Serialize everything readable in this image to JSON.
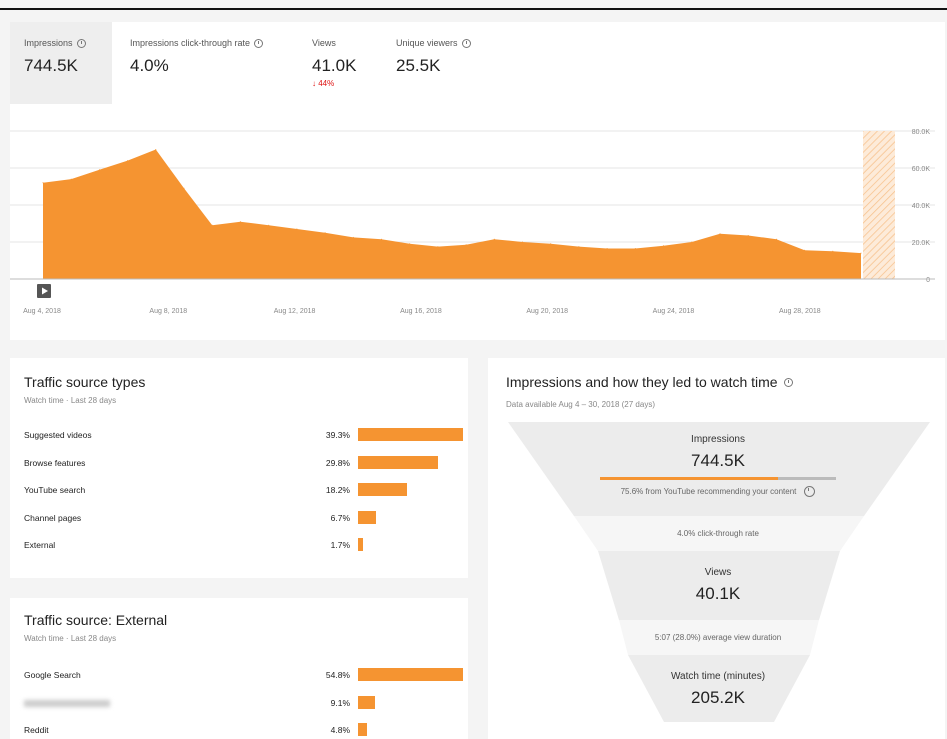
{
  "overview": {
    "metrics": [
      {
        "label": "Impressions",
        "value": "744.5K",
        "delta": ""
      },
      {
        "label": "Impressions click-through rate",
        "value": "4.0%",
        "delta": ""
      },
      {
        "label": "Views",
        "value": "41.0K",
        "delta": "44%"
      },
      {
        "label": "Unique viewers",
        "value": "25.5K",
        "delta": ""
      }
    ]
  },
  "chart_data": {
    "type": "area",
    "title": "",
    "xlabel": "",
    "ylabel": "",
    "x_tick_labels": [
      "Aug 4, 2018",
      "Aug 8, 2018",
      "Aug 12, 2018",
      "Aug 16, 2018",
      "Aug 20, 2018",
      "Aug 24, 2018",
      "Aug 28, 2018"
    ],
    "y_tick_labels": [
      "0",
      "20.0K",
      "40.0K",
      "60.0K",
      "80.0K"
    ],
    "ylim": [
      0,
      80000
    ],
    "x": [
      "Aug 4, 2018",
      "Aug 5, 2018",
      "Aug 6, 2018",
      "Aug 7, 2018",
      "Aug 8, 2018",
      "Aug 9, 2018",
      "Aug 10, 2018",
      "Aug 11, 2018",
      "Aug 12, 2018",
      "Aug 13, 2018",
      "Aug 14, 2018",
      "Aug 15, 2018",
      "Aug 16, 2018",
      "Aug 17, 2018",
      "Aug 18, 2018",
      "Aug 19, 2018",
      "Aug 20, 2018",
      "Aug 21, 2018",
      "Aug 22, 2018",
      "Aug 23, 2018",
      "Aug 24, 2018",
      "Aug 25, 2018",
      "Aug 26, 2018",
      "Aug 27, 2018",
      "Aug 28, 2018",
      "Aug 29, 2018",
      "Aug 30, 2018"
    ],
    "series": [
      {
        "values": [
          52000,
          54000,
          59000,
          64000,
          70000,
          49000,
          29000,
          31000,
          29000,
          27000,
          25000,
          22500,
          21500,
          19000,
          17500,
          18500,
          21500,
          20000,
          19000,
          17500,
          16500,
          16500,
          18000,
          20000,
          24500,
          23500,
          21500,
          15500,
          15000,
          14000
        ]
      }
    ],
    "grid": true,
    "color": "#f59431",
    "partial_period_shaded": true
  },
  "traffic_types": {
    "title": "Traffic source types",
    "subtitle": "Watch time · Last 28 days",
    "rows": [
      {
        "label": "Suggested videos",
        "pct": "39.3%",
        "value": 39.3
      },
      {
        "label": "Browse features",
        "pct": "29.8%",
        "value": 29.8
      },
      {
        "label": "YouTube search",
        "pct": "18.2%",
        "value": 18.2
      },
      {
        "label": "Channel pages",
        "pct": "6.7%",
        "value": 6.7
      },
      {
        "label": "External",
        "pct": "1.7%",
        "value": 1.7
      }
    ]
  },
  "traffic_external": {
    "title": "Traffic source: External",
    "subtitle": "Watch time · Last 28 days",
    "rows": [
      {
        "label": "Google Search",
        "pct": "54.8%",
        "value": 54.8,
        "blurred": false
      },
      {
        "label": "",
        "pct": "9.1%",
        "value": 9.1,
        "blurred": true
      },
      {
        "label": "Reddit",
        "pct": "4.8%",
        "value": 4.8,
        "blurred": false
      }
    ]
  },
  "funnel": {
    "title": "Impressions and how they led to watch time",
    "subtitle": "Data available Aug 4 – 30, 2018 (27 days)",
    "impressions_label": "Impressions",
    "impressions_value": "744.5K",
    "recommend_fraction": 0.756,
    "recommend_note": "75.6% from YouTube recommending your content",
    "ctr_note": "4.0% click-through rate",
    "views_label": "Views",
    "views_value": "40.1K",
    "duration_note": "5:07 (28.0%) average view duration",
    "watch_label": "Watch time (minutes)",
    "watch_value": "205.2K"
  },
  "colors": {
    "accent": "#f59431",
    "negative": "#d11111"
  }
}
